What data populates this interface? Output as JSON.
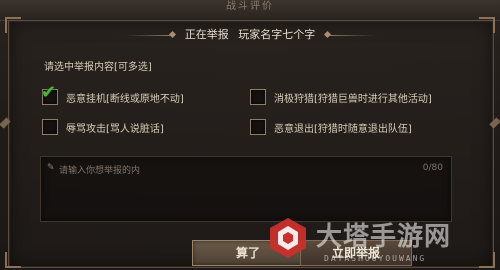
{
  "window": {
    "top_title": "战斗评价"
  },
  "report_dialog": {
    "header_prefix": "正在举报",
    "player_name": "玩家名字七个字",
    "select_hint": "请选中举报内容[可多选]",
    "options": [
      {
        "label": "恶意挂机[断线或原地不动]",
        "checked": true
      },
      {
        "label": "消极狩猎[狩猎巨兽时进行其他活动]",
        "checked": false
      },
      {
        "label": "辱骂攻击[骂人说脏话]",
        "checked": false
      },
      {
        "label": "恶意退出[狩猎时随意退出队伍]",
        "checked": false
      }
    ],
    "textarea": {
      "placeholder": "请输入你想举报的内",
      "counter": "0/80"
    },
    "cancel_button": "算了",
    "report_button": "立即举报"
  },
  "watermark": {
    "title": "大塔手游网",
    "subtitle": "DATASHOUYOUWANG"
  },
  "colors": {
    "check_green": "#52b33b",
    "panel_border": "#5a4c3f",
    "text_primary": "#d9ceba"
  }
}
